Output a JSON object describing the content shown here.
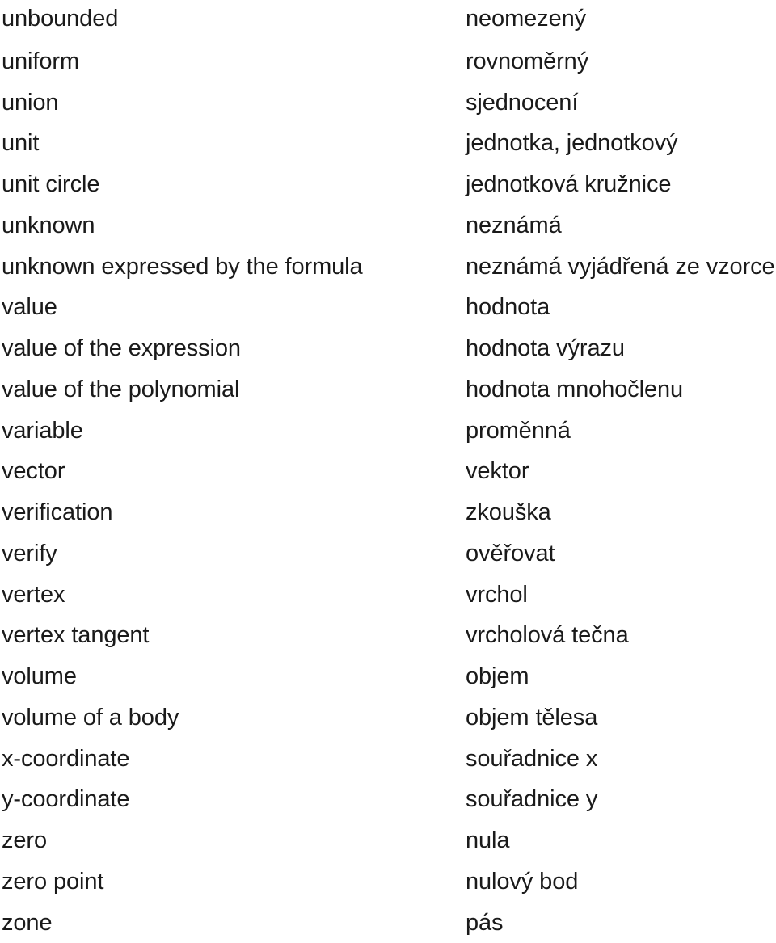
{
  "document": {
    "type": "bilingual-glossary",
    "source_language": "English",
    "target_language": "Czech",
    "text_color": "#1a1a1a",
    "background_color": "#ffffff"
  },
  "entries": [
    {
      "term": "unbounded",
      "translation": "neomezený"
    },
    {
      "term": "uniform",
      "translation": "rovnoměrný"
    },
    {
      "term": "union",
      "translation": "sjednocení"
    },
    {
      "term": "unit",
      "translation": "jednotka, jednotkový"
    },
    {
      "term": "unit circle",
      "translation": "jednotková kružnice"
    },
    {
      "term": "unknown",
      "translation": "neznámá"
    },
    {
      "term": "unknown expressed by the formula",
      "translation": "neznámá vyjádřená ze vzorce"
    },
    {
      "term": "value",
      "translation": "hodnota"
    },
    {
      "term": "value of the expression",
      "translation": "hodnota výrazu"
    },
    {
      "term": "value of the polynomial",
      "translation": "hodnota mnohočlenu"
    },
    {
      "term": "variable",
      "translation": "proměnná"
    },
    {
      "term": "vector",
      "translation": "vektor"
    },
    {
      "term": "verification",
      "translation": "zkouška"
    },
    {
      "term": "verify",
      "translation": "ověřovat"
    },
    {
      "term": "vertex",
      "translation": "vrchol"
    },
    {
      "term": "vertex tangent",
      "translation": "vrcholová tečna"
    },
    {
      "term": "volume",
      "translation": "objem"
    },
    {
      "term": "volume of a body",
      "translation": "objem tělesa"
    },
    {
      "term": "x-coordinate",
      "translation": "souřadnice x"
    },
    {
      "term": "y-coordinate",
      "translation": "souřadnice y"
    },
    {
      "term": "zero",
      "translation": "nula"
    },
    {
      "term": "zero point",
      "translation": "nulový bod"
    },
    {
      "term": "zone",
      "translation": "pás"
    }
  ]
}
